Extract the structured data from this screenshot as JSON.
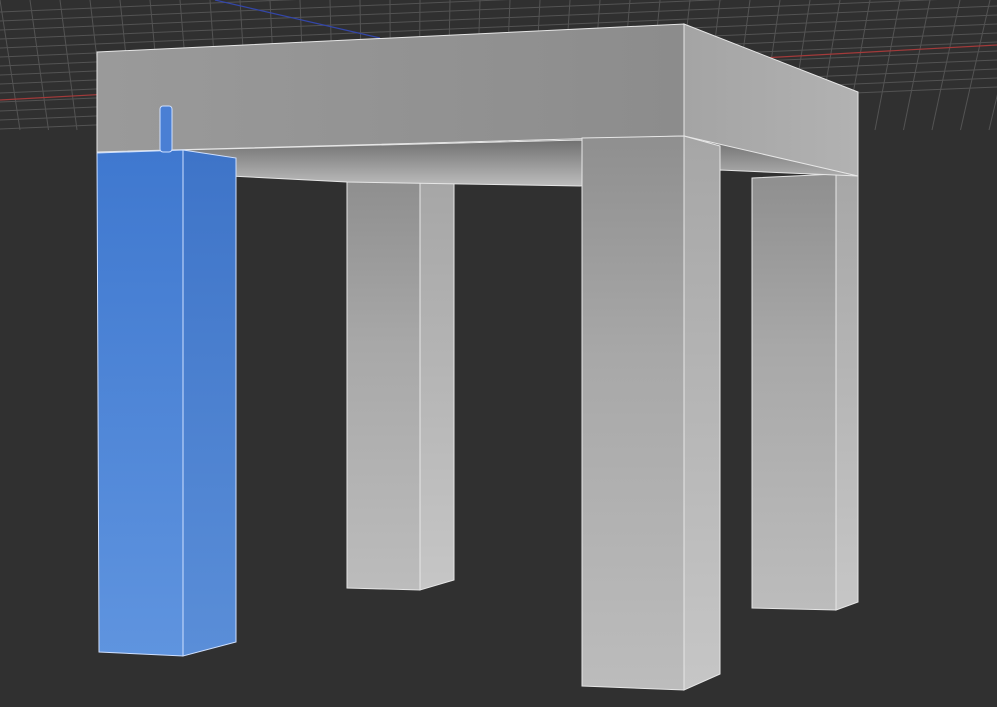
{
  "viewport": {
    "background_color": "#303030",
    "grid_color": "#5a5a5a",
    "axis_x_color": "#a33a3a",
    "axis_y_color": "#3346a8",
    "selection_color": "#4a7fd4",
    "mesh_color": "#b9b9b9",
    "edge_color": "#e6e6e6",
    "objects": [
      {
        "name": "tabletop",
        "selected": false
      },
      {
        "name": "leg-front-left",
        "selected": true
      },
      {
        "name": "leg-back-left",
        "selected": false
      },
      {
        "name": "leg-front-right",
        "selected": false
      },
      {
        "name": "leg-back-right",
        "selected": false
      }
    ],
    "gizmo": {
      "name": "pivot-gizmo",
      "visible": true
    }
  }
}
